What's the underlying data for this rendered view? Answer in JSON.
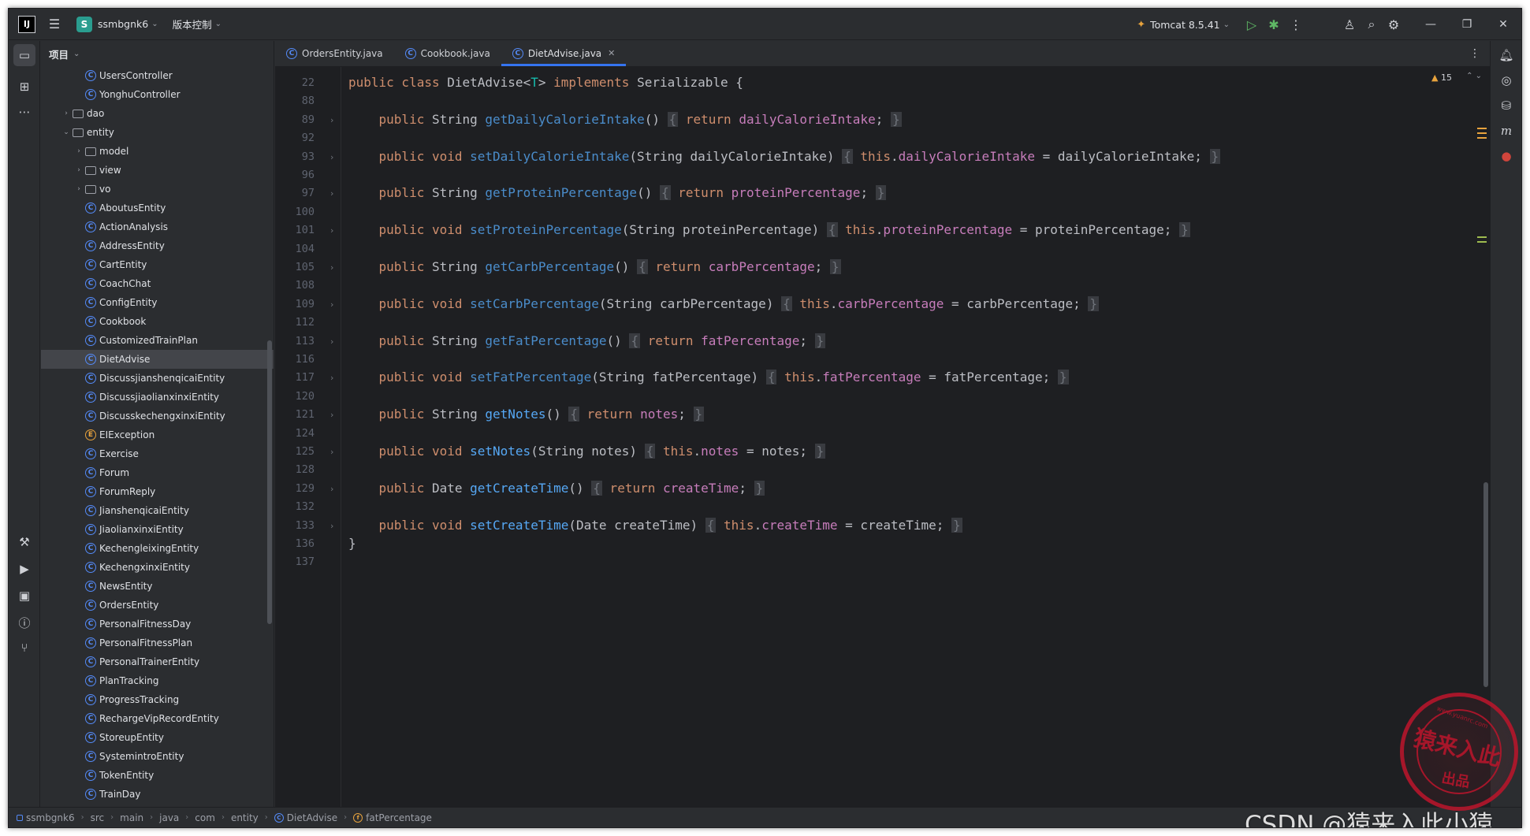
{
  "titlebar": {
    "project_badge": "S",
    "project_name": "ssmbgnk6",
    "vcs_label": "版本控制",
    "run_config": "Tomcat 8.5.41"
  },
  "project_panel": {
    "title": "项目",
    "items": [
      {
        "label": "UsersController",
        "kind": "class",
        "indent": 3,
        "arrow": ""
      },
      {
        "label": "YonghuController",
        "kind": "class",
        "indent": 3,
        "arrow": ""
      },
      {
        "label": "dao",
        "kind": "folder",
        "indent": 2,
        "arrow": "›"
      },
      {
        "label": "entity",
        "kind": "folder",
        "indent": 2,
        "arrow": "⌄"
      },
      {
        "label": "model",
        "kind": "folder",
        "indent": 3,
        "arrow": "›"
      },
      {
        "label": "view",
        "kind": "folder",
        "indent": 3,
        "arrow": "›"
      },
      {
        "label": "vo",
        "kind": "folder",
        "indent": 3,
        "arrow": "›"
      },
      {
        "label": "AboutusEntity",
        "kind": "class",
        "indent": 3,
        "arrow": ""
      },
      {
        "label": "ActionAnalysis",
        "kind": "class",
        "indent": 3,
        "arrow": ""
      },
      {
        "label": "AddressEntity",
        "kind": "class",
        "indent": 3,
        "arrow": ""
      },
      {
        "label": "CartEntity",
        "kind": "class",
        "indent": 3,
        "arrow": ""
      },
      {
        "label": "CoachChat",
        "kind": "class",
        "indent": 3,
        "arrow": ""
      },
      {
        "label": "ConfigEntity",
        "kind": "class",
        "indent": 3,
        "arrow": ""
      },
      {
        "label": "Cookbook",
        "kind": "class",
        "indent": 3,
        "arrow": ""
      },
      {
        "label": "CustomizedTrainPlan",
        "kind": "class",
        "indent": 3,
        "arrow": ""
      },
      {
        "label": "DietAdvise",
        "kind": "class",
        "indent": 3,
        "arrow": "",
        "selected": true
      },
      {
        "label": "DiscussjianshenqicaiEntity",
        "kind": "class",
        "indent": 3,
        "arrow": ""
      },
      {
        "label": "DiscussjiaolianxinxiEntity",
        "kind": "class",
        "indent": 3,
        "arrow": ""
      },
      {
        "label": "DiscusskechengxinxiEntity",
        "kind": "class",
        "indent": 3,
        "arrow": ""
      },
      {
        "label": "EIException",
        "kind": "exception",
        "indent": 3,
        "arrow": ""
      },
      {
        "label": "Exercise",
        "kind": "class",
        "indent": 3,
        "arrow": ""
      },
      {
        "label": "Forum",
        "kind": "class",
        "indent": 3,
        "arrow": ""
      },
      {
        "label": "ForumReply",
        "kind": "class",
        "indent": 3,
        "arrow": ""
      },
      {
        "label": "JianshenqicaiEntity",
        "kind": "class",
        "indent": 3,
        "arrow": ""
      },
      {
        "label": "JiaolianxinxiEntity",
        "kind": "class",
        "indent": 3,
        "arrow": ""
      },
      {
        "label": "KechengleixingEntity",
        "kind": "class",
        "indent": 3,
        "arrow": ""
      },
      {
        "label": "KechengxinxiEntity",
        "kind": "class",
        "indent": 3,
        "arrow": ""
      },
      {
        "label": "NewsEntity",
        "kind": "class",
        "indent": 3,
        "arrow": ""
      },
      {
        "label": "OrdersEntity",
        "kind": "class",
        "indent": 3,
        "arrow": ""
      },
      {
        "label": "PersonalFitnessDay",
        "kind": "class",
        "indent": 3,
        "arrow": ""
      },
      {
        "label": "PersonalFitnessPlan",
        "kind": "class",
        "indent": 3,
        "arrow": ""
      },
      {
        "label": "PersonalTrainerEntity",
        "kind": "class",
        "indent": 3,
        "arrow": ""
      },
      {
        "label": "PlanTracking",
        "kind": "class",
        "indent": 3,
        "arrow": ""
      },
      {
        "label": "ProgressTracking",
        "kind": "class",
        "indent": 3,
        "arrow": ""
      },
      {
        "label": "RechargeVipRecordEntity",
        "kind": "class",
        "indent": 3,
        "arrow": ""
      },
      {
        "label": "StoreupEntity",
        "kind": "class",
        "indent": 3,
        "arrow": ""
      },
      {
        "label": "SystemintroEntity",
        "kind": "class",
        "indent": 3,
        "arrow": ""
      },
      {
        "label": "TokenEntity",
        "kind": "class",
        "indent": 3,
        "arrow": ""
      },
      {
        "label": "TrainDay",
        "kind": "class",
        "indent": 3,
        "arrow": ""
      }
    ]
  },
  "tabs": [
    {
      "label": "OrdersEntity.java",
      "active": false
    },
    {
      "label": "Cookbook.java",
      "active": false
    },
    {
      "label": "DietAdvise.java",
      "active": true
    }
  ],
  "editor": {
    "warnings": "15",
    "line_numbers": [
      "22",
      "88",
      "89",
      "92",
      "93",
      "96",
      "97",
      "100",
      "101",
      "104",
      "105",
      "108",
      "109",
      "112",
      "113",
      "116",
      "117",
      "120",
      "121",
      "124",
      "125",
      "128",
      "129",
      "132",
      "133",
      "136",
      "137"
    ],
    "code_lines": [
      [
        {
          "t": "public class ",
          "c": "kw"
        },
        {
          "t": "DietAdvise",
          "c": "tp"
        },
        {
          "t": "<",
          "c": "tp"
        },
        {
          "t": "T",
          "c": "gen"
        },
        {
          "t": "> ",
          "c": "tp"
        },
        {
          "t": "implements ",
          "c": "kw"
        },
        {
          "t": "Serializable {",
          "c": "tp"
        }
      ],
      [],
      [
        {
          "t": "    public ",
          "c": "kw"
        },
        {
          "t": "String ",
          "c": "tp"
        },
        {
          "t": "getDailyCalorieIntake",
          "c": "fnd"
        },
        {
          "t": "() ",
          "c": "tp"
        },
        {
          "t": "{",
          "c": "br"
        },
        {
          "t": " return ",
          "c": "kw"
        },
        {
          "t": "dailyCalorieIntake",
          "c": "fld"
        },
        {
          "t": "; ",
          "c": "tp"
        },
        {
          "t": "}",
          "c": "br"
        }
      ],
      [],
      [
        {
          "t": "    public void ",
          "c": "kw"
        },
        {
          "t": "setDailyCalorieIntake",
          "c": "fnd"
        },
        {
          "t": "(String dailyCalorieIntake) ",
          "c": "tp"
        },
        {
          "t": "{",
          "c": "br"
        },
        {
          "t": " this",
          "c": "kw"
        },
        {
          "t": ".",
          "c": "tp"
        },
        {
          "t": "dailyCalorieIntake",
          "c": "fld"
        },
        {
          "t": " = dailyCalorieIntake; ",
          "c": "tp"
        },
        {
          "t": "}",
          "c": "br"
        }
      ],
      [],
      [
        {
          "t": "    public ",
          "c": "kw"
        },
        {
          "t": "String ",
          "c": "tp"
        },
        {
          "t": "getProteinPercentage",
          "c": "fnd"
        },
        {
          "t": "() ",
          "c": "tp"
        },
        {
          "t": "{",
          "c": "br"
        },
        {
          "t": " return ",
          "c": "kw"
        },
        {
          "t": "proteinPercentage",
          "c": "fld"
        },
        {
          "t": "; ",
          "c": "tp"
        },
        {
          "t": "}",
          "c": "br"
        }
      ],
      [],
      [
        {
          "t": "    public void ",
          "c": "kw"
        },
        {
          "t": "setProteinPercentage",
          "c": "fnd"
        },
        {
          "t": "(String proteinPercentage) ",
          "c": "tp"
        },
        {
          "t": "{",
          "c": "br"
        },
        {
          "t": " this",
          "c": "kw"
        },
        {
          "t": ".",
          "c": "tp"
        },
        {
          "t": "proteinPercentage",
          "c": "fld"
        },
        {
          "t": " = proteinPercentage; ",
          "c": "tp"
        },
        {
          "t": "}",
          "c": "br"
        }
      ],
      [],
      [
        {
          "t": "    public ",
          "c": "kw"
        },
        {
          "t": "String ",
          "c": "tp"
        },
        {
          "t": "getCarbPercentage",
          "c": "fnd"
        },
        {
          "t": "() ",
          "c": "tp"
        },
        {
          "t": "{",
          "c": "br"
        },
        {
          "t": " return ",
          "c": "kw"
        },
        {
          "t": "carbPercentage",
          "c": "fld"
        },
        {
          "t": "; ",
          "c": "tp"
        },
        {
          "t": "}",
          "c": "br"
        }
      ],
      [],
      [
        {
          "t": "    public void ",
          "c": "kw"
        },
        {
          "t": "setCarbPercentage",
          "c": "fnd"
        },
        {
          "t": "(String carbPercentage) ",
          "c": "tp"
        },
        {
          "t": "{",
          "c": "br"
        },
        {
          "t": " this",
          "c": "kw"
        },
        {
          "t": ".",
          "c": "tp"
        },
        {
          "t": "carbPercentage",
          "c": "fld"
        },
        {
          "t": " = carbPercentage; ",
          "c": "tp"
        },
        {
          "t": "}",
          "c": "br"
        }
      ],
      [],
      [
        {
          "t": "    public ",
          "c": "kw"
        },
        {
          "t": "String ",
          "c": "tp"
        },
        {
          "t": "getFatPercentage",
          "c": "fnd"
        },
        {
          "t": "() ",
          "c": "tp"
        },
        {
          "t": "{",
          "c": "br"
        },
        {
          "t": " return ",
          "c": "kw"
        },
        {
          "t": "fatPercentage",
          "c": "fld"
        },
        {
          "t": "; ",
          "c": "tp"
        },
        {
          "t": "}",
          "c": "br"
        }
      ],
      [],
      [
        {
          "t": "    public void ",
          "c": "kw"
        },
        {
          "t": "setFatPercentage",
          "c": "fnd"
        },
        {
          "t": "(String fatPercentage) ",
          "c": "tp"
        },
        {
          "t": "{",
          "c": "br"
        },
        {
          "t": " this",
          "c": "kw"
        },
        {
          "t": ".",
          "c": "tp"
        },
        {
          "t": "fatPercentage",
          "c": "fld"
        },
        {
          "t": " = fatPercentage; ",
          "c": "tp"
        },
        {
          "t": "}",
          "c": "br"
        }
      ],
      [],
      [
        {
          "t": "    public ",
          "c": "kw"
        },
        {
          "t": "String ",
          "c": "tp"
        },
        {
          "t": "getNotes",
          "c": "fn"
        },
        {
          "t": "() ",
          "c": "tp"
        },
        {
          "t": "{",
          "c": "br"
        },
        {
          "t": " return ",
          "c": "kw"
        },
        {
          "t": "notes",
          "c": "fld"
        },
        {
          "t": "; ",
          "c": "tp"
        },
        {
          "t": "}",
          "c": "br"
        }
      ],
      [],
      [
        {
          "t": "    public void ",
          "c": "kw"
        },
        {
          "t": "setNotes",
          "c": "fn"
        },
        {
          "t": "(String notes) ",
          "c": "tp"
        },
        {
          "t": "{",
          "c": "br"
        },
        {
          "t": " this",
          "c": "kw"
        },
        {
          "t": ".",
          "c": "tp"
        },
        {
          "t": "notes",
          "c": "fld"
        },
        {
          "t": " = notes; ",
          "c": "tp"
        },
        {
          "t": "}",
          "c": "br"
        }
      ],
      [],
      [
        {
          "t": "    public ",
          "c": "kw"
        },
        {
          "t": "Date ",
          "c": "tp"
        },
        {
          "t": "getCreateTime",
          "c": "fn"
        },
        {
          "t": "() ",
          "c": "tp"
        },
        {
          "t": "{",
          "c": "br"
        },
        {
          "t": " return ",
          "c": "kw"
        },
        {
          "t": "createTime",
          "c": "fld"
        },
        {
          "t": "; ",
          "c": "tp"
        },
        {
          "t": "}",
          "c": "br"
        }
      ],
      [],
      [
        {
          "t": "    public void ",
          "c": "kw"
        },
        {
          "t": "setCreateTime",
          "c": "fn"
        },
        {
          "t": "(Date createTime) ",
          "c": "tp"
        },
        {
          "t": "{",
          "c": "br"
        },
        {
          "t": " this",
          "c": "kw"
        },
        {
          "t": ".",
          "c": "tp"
        },
        {
          "t": "createTime",
          "c": "fld"
        },
        {
          "t": " = createTime; ",
          "c": "tp"
        },
        {
          "t": "}",
          "c": "br"
        }
      ],
      [
        {
          "t": "}",
          "c": "tp"
        }
      ],
      []
    ]
  },
  "statusbar": {
    "breadcrumbs": [
      "ssmbgnk6",
      "src",
      "main",
      "java",
      "com",
      "entity",
      "DietAdvise",
      "fatPercentage"
    ]
  },
  "watermark": {
    "text": "CSDN @猿来入此小猿",
    "stamp_main": "猿来入此",
    "stamp_sub": "出品",
    "stamp_url": "www.yuanrc.com"
  },
  "colors": {
    "accent": "#3574f0",
    "keyword": "#cf8e6d",
    "method": "#56a8f5",
    "field": "#c77dbb",
    "warning": "#e8a33d",
    "stamp": "#b5162b"
  }
}
